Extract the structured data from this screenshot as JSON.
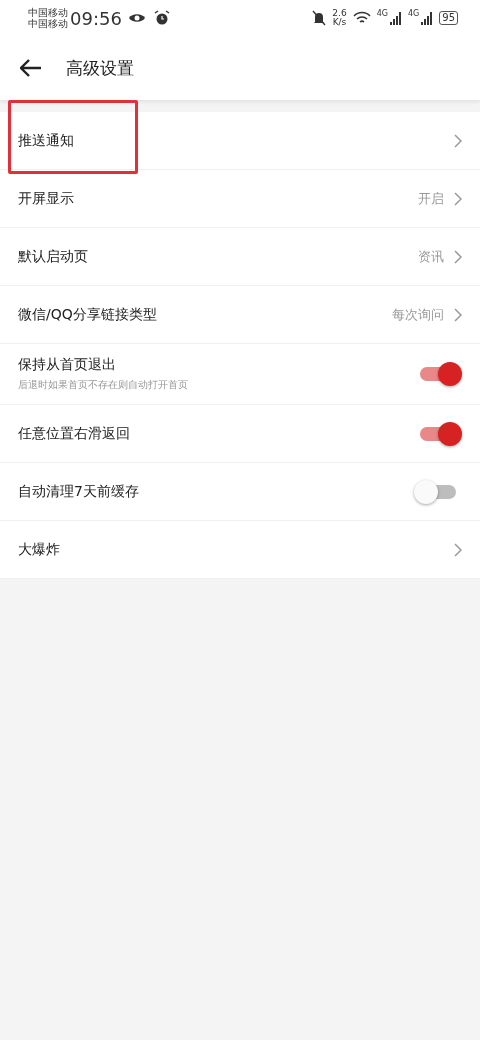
{
  "status_bar": {
    "carriers": [
      "中国移动",
      "中国移动"
    ],
    "time": "09:56",
    "speed_value": "2.6",
    "speed_unit": "K/s",
    "network_labels": [
      "4G",
      "4G"
    ],
    "battery": "95"
  },
  "header": {
    "title": "高级设置"
  },
  "settings": [
    {
      "kind": "link",
      "label": "推送通知",
      "highlighted": true
    },
    {
      "kind": "link",
      "label": "开屏显示",
      "value": "开启",
      "highlighted": false
    },
    {
      "kind": "link",
      "label": "默认启动页",
      "value": "资讯",
      "highlighted": false
    },
    {
      "kind": "link",
      "label": "微信/QQ分享链接类型",
      "value": "每次询问",
      "highlighted": false
    },
    {
      "kind": "toggle",
      "label": "保持从首页退出",
      "description": "后退时如果首页不存在则自动打开首页",
      "on": true,
      "highlighted": false
    },
    {
      "kind": "toggle",
      "label": "任意位置右滑返回",
      "on": true,
      "highlighted": false
    },
    {
      "kind": "toggle",
      "label": "自动清理7天前缓存",
      "on": false,
      "highlighted": false
    },
    {
      "kind": "link",
      "label": "大爆炸",
      "highlighted": false
    }
  ]
}
